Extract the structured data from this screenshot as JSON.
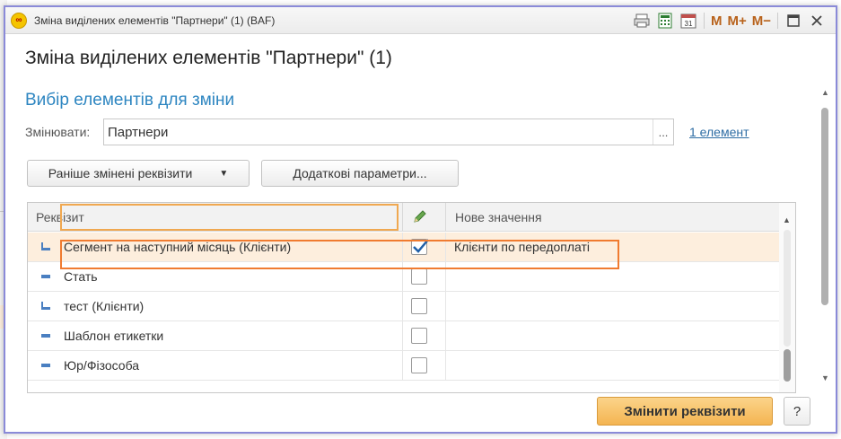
{
  "window": {
    "title": "Зміна виділених елементів \"Партнери\" (1)  (BAF)",
    "toolbar": {
      "m_label": "M",
      "mplus_label": "M+",
      "mminus_label": "M−",
      "calendar_day": "31"
    }
  },
  "form": {
    "title": "Зміна виділених елементів \"Партнери\" (1)",
    "section_title": "Вибір елементів для зміни",
    "change_label": "Змінювати:",
    "change_value": "Партнери",
    "select_button": "...",
    "element_link": "1 елемент"
  },
  "buttons": {
    "previous": "Раніше змінені реквізити",
    "extra": "Додаткові параметри...",
    "apply": "Змінити реквізити",
    "help": "?"
  },
  "grid": {
    "col_attribute": "Реквізит",
    "col_new_value": "Нове значення",
    "rows": [
      {
        "name": "Сегмент на наступний місяць (Клієнти)",
        "checked": true,
        "value": "Клієнти по передоплаті",
        "icon": "attribute-extra-icon"
      },
      {
        "name": "Стать",
        "checked": false,
        "value": "",
        "icon": "attribute-icon"
      },
      {
        "name": "тест (Клієнти)",
        "checked": false,
        "value": "",
        "icon": "attribute-extra-icon"
      },
      {
        "name": "Шаблон етикетки",
        "checked": false,
        "value": "",
        "icon": "attribute-icon"
      },
      {
        "name": "Юр/Фізособа",
        "checked": false,
        "value": "",
        "icon": "attribute-icon"
      }
    ]
  },
  "colors": {
    "accent_blue": "#2e86c1",
    "selected_row": "#fdeedd",
    "highlight_orange": "#f07b30",
    "apply_button": "#f4b451"
  }
}
